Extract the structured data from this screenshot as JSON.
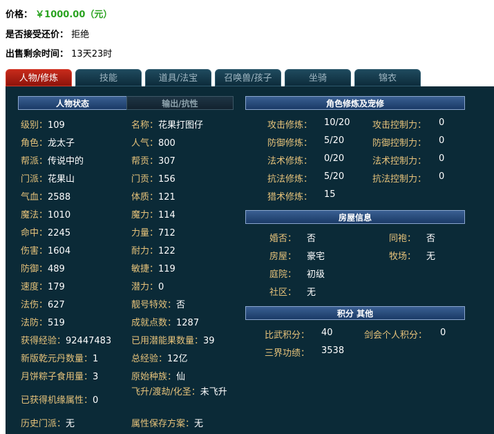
{
  "info": {
    "price_label": "价格：",
    "price_value": "￥1000.00（元）",
    "bargain_label": "是否接受还价：",
    "bargain_value": "拒绝",
    "time_label": "出售剩余时间：",
    "time_value": "13天23时"
  },
  "tabs": [
    "人物/修炼",
    "技能",
    "道具/法宝",
    "召唤兽/孩子",
    "坐骑",
    "锦衣"
  ],
  "status": {
    "tab_active": "人物状态",
    "tab_inactive": "输出/抗性",
    "left": [
      {
        "k": "级别：",
        "v": "109"
      },
      {
        "k": "角色：",
        "v": "龙太子"
      },
      {
        "k": "帮派：",
        "v": "传说中的"
      },
      {
        "k": "门派：",
        "v": "花果山"
      },
      {
        "k": "气血：",
        "v": "2588"
      },
      {
        "k": "魔法：",
        "v": "1010"
      },
      {
        "k": "命中：",
        "v": "2245"
      },
      {
        "k": "伤害：",
        "v": "1604"
      },
      {
        "k": "防御：",
        "v": "489"
      },
      {
        "k": "速度：",
        "v": "179"
      },
      {
        "k": "法伤：",
        "v": "627"
      },
      {
        "k": "法防：",
        "v": "519"
      },
      {
        "k": "获得经验：",
        "v": "92447483"
      },
      {
        "k": "新版乾元丹数量：",
        "v": "1"
      },
      {
        "k": "月饼粽子食用量：",
        "v": "3"
      },
      {
        "k": "已获得机缘属性：",
        "v": "0"
      },
      {
        "k": "历史门派：",
        "v": "无"
      }
    ],
    "right": [
      {
        "k": "名称：",
        "v": "花果打图仔"
      },
      {
        "k": "人气：",
        "v": "800"
      },
      {
        "k": "帮贡：",
        "v": "307"
      },
      {
        "k": "门贡：",
        "v": "156"
      },
      {
        "k": "体质：",
        "v": "121"
      },
      {
        "k": "魔力：",
        "v": "114"
      },
      {
        "k": "力量：",
        "v": "712"
      },
      {
        "k": "耐力：",
        "v": "122"
      },
      {
        "k": "敏捷：",
        "v": "119"
      },
      {
        "k": "潜力：",
        "v": "0"
      },
      {
        "k": "靓号特效：",
        "v": "否"
      },
      {
        "k": "成就点数：",
        "v": "1287"
      },
      {
        "k": "已用潜能果数量：",
        "v": "39"
      },
      {
        "k": "总经验：",
        "v": "12亿"
      },
      {
        "k": "原始种族：",
        "v": "仙"
      },
      {
        "k": "飞升/渡劫/化圣：",
        "v": "未飞升"
      },
      {
        "k": "属性保存方案：",
        "v": "无"
      }
    ]
  },
  "cultivation": {
    "title": "角色修炼及宠修",
    "rows": [
      {
        "k1": "攻击修炼：",
        "v1": "10/20",
        "k2": "攻击控制力：",
        "v2": "0"
      },
      {
        "k1": "防御修炼：",
        "v1": "5/20",
        "k2": "防御控制力：",
        "v2": "0"
      },
      {
        "k1": "法术修炼：",
        "v1": "0/20",
        "k2": "法术控制力：",
        "v2": "0"
      },
      {
        "k1": "抗法修炼：",
        "v1": "5/20",
        "k2": "抗法控制力：",
        "v2": "0"
      },
      {
        "k1": "猎术修炼：",
        "v1": "15",
        "k2": "",
        "v2": ""
      }
    ]
  },
  "house": {
    "title": "房屋信息",
    "rows": [
      {
        "k1": "婚否：",
        "v1": "否",
        "k2": "同袍：",
        "v2": "否"
      },
      {
        "k1": "房屋：",
        "v1": "豪宅",
        "k2": "牧场：",
        "v2": "无"
      },
      {
        "k1": "庭院：",
        "v1": "初级",
        "k2": "",
        "v2": ""
      },
      {
        "k1": "社区：",
        "v1": "无",
        "k2": "",
        "v2": ""
      }
    ]
  },
  "score": {
    "title": "积分 其他",
    "rows": [
      {
        "k1": "比武积分：",
        "v1": "40",
        "k2": "剑会个人积分：",
        "v2": "0"
      },
      {
        "k1": "三界功绩：",
        "v1": "3538",
        "k2": "",
        "v2": ""
      }
    ]
  }
}
